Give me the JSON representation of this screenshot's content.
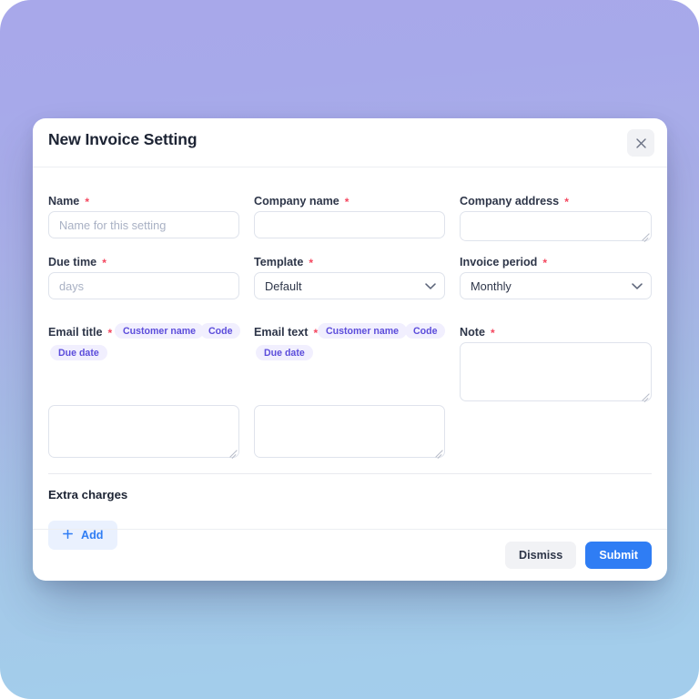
{
  "theme": {
    "bg_gradient_top": "#a8a8ea",
    "bg_gradient_bottom": "#a3cdec",
    "accent_blue": "#2f7df4",
    "chip_bg": "#f1effe",
    "chip_text": "#5c4ddb",
    "required_asterisk": "#f4475f",
    "card_bg": "#ffffff"
  },
  "modal": {
    "title": "New Invoice Setting",
    "close_icon": "close-icon",
    "close_label": "×"
  },
  "form": {
    "name": {
      "label": "Name",
      "required": "*",
      "value": "",
      "placeholder": "Name for this setting"
    },
    "company_name": {
      "label": "Company name",
      "required": "*",
      "value": "",
      "placeholder": ""
    },
    "company_address": {
      "label": "Company address",
      "required": "*",
      "value": "",
      "placeholder": ""
    },
    "due_time": {
      "label": "Due time",
      "required": "*",
      "value": "",
      "placeholder": "days"
    },
    "template": {
      "label": "Template",
      "required": "*",
      "selected": "Default",
      "chevron_icon": "chevron-down-icon"
    },
    "invoice_period": {
      "label": "Invoice period",
      "required": "*",
      "selected": "Monthly",
      "chevron_icon": "chevron-down-icon"
    },
    "email_title": {
      "label": "Email title",
      "required": "*",
      "value": "",
      "chips": [
        "Customer name",
        "Code",
        "Due date"
      ]
    },
    "email_text": {
      "label": "Email text",
      "required": "*",
      "value": "",
      "chips": [
        "Customer name",
        "Code",
        "Due date"
      ]
    },
    "note": {
      "label": "Note",
      "required": "*",
      "value": "",
      "placeholder": ""
    }
  },
  "extra_charges": {
    "section_title": "Extra charges",
    "add_label": "Add",
    "add_icon": "plus-icon"
  },
  "footer": {
    "dismiss_label": "Dismiss",
    "submit_label": "Submit"
  }
}
